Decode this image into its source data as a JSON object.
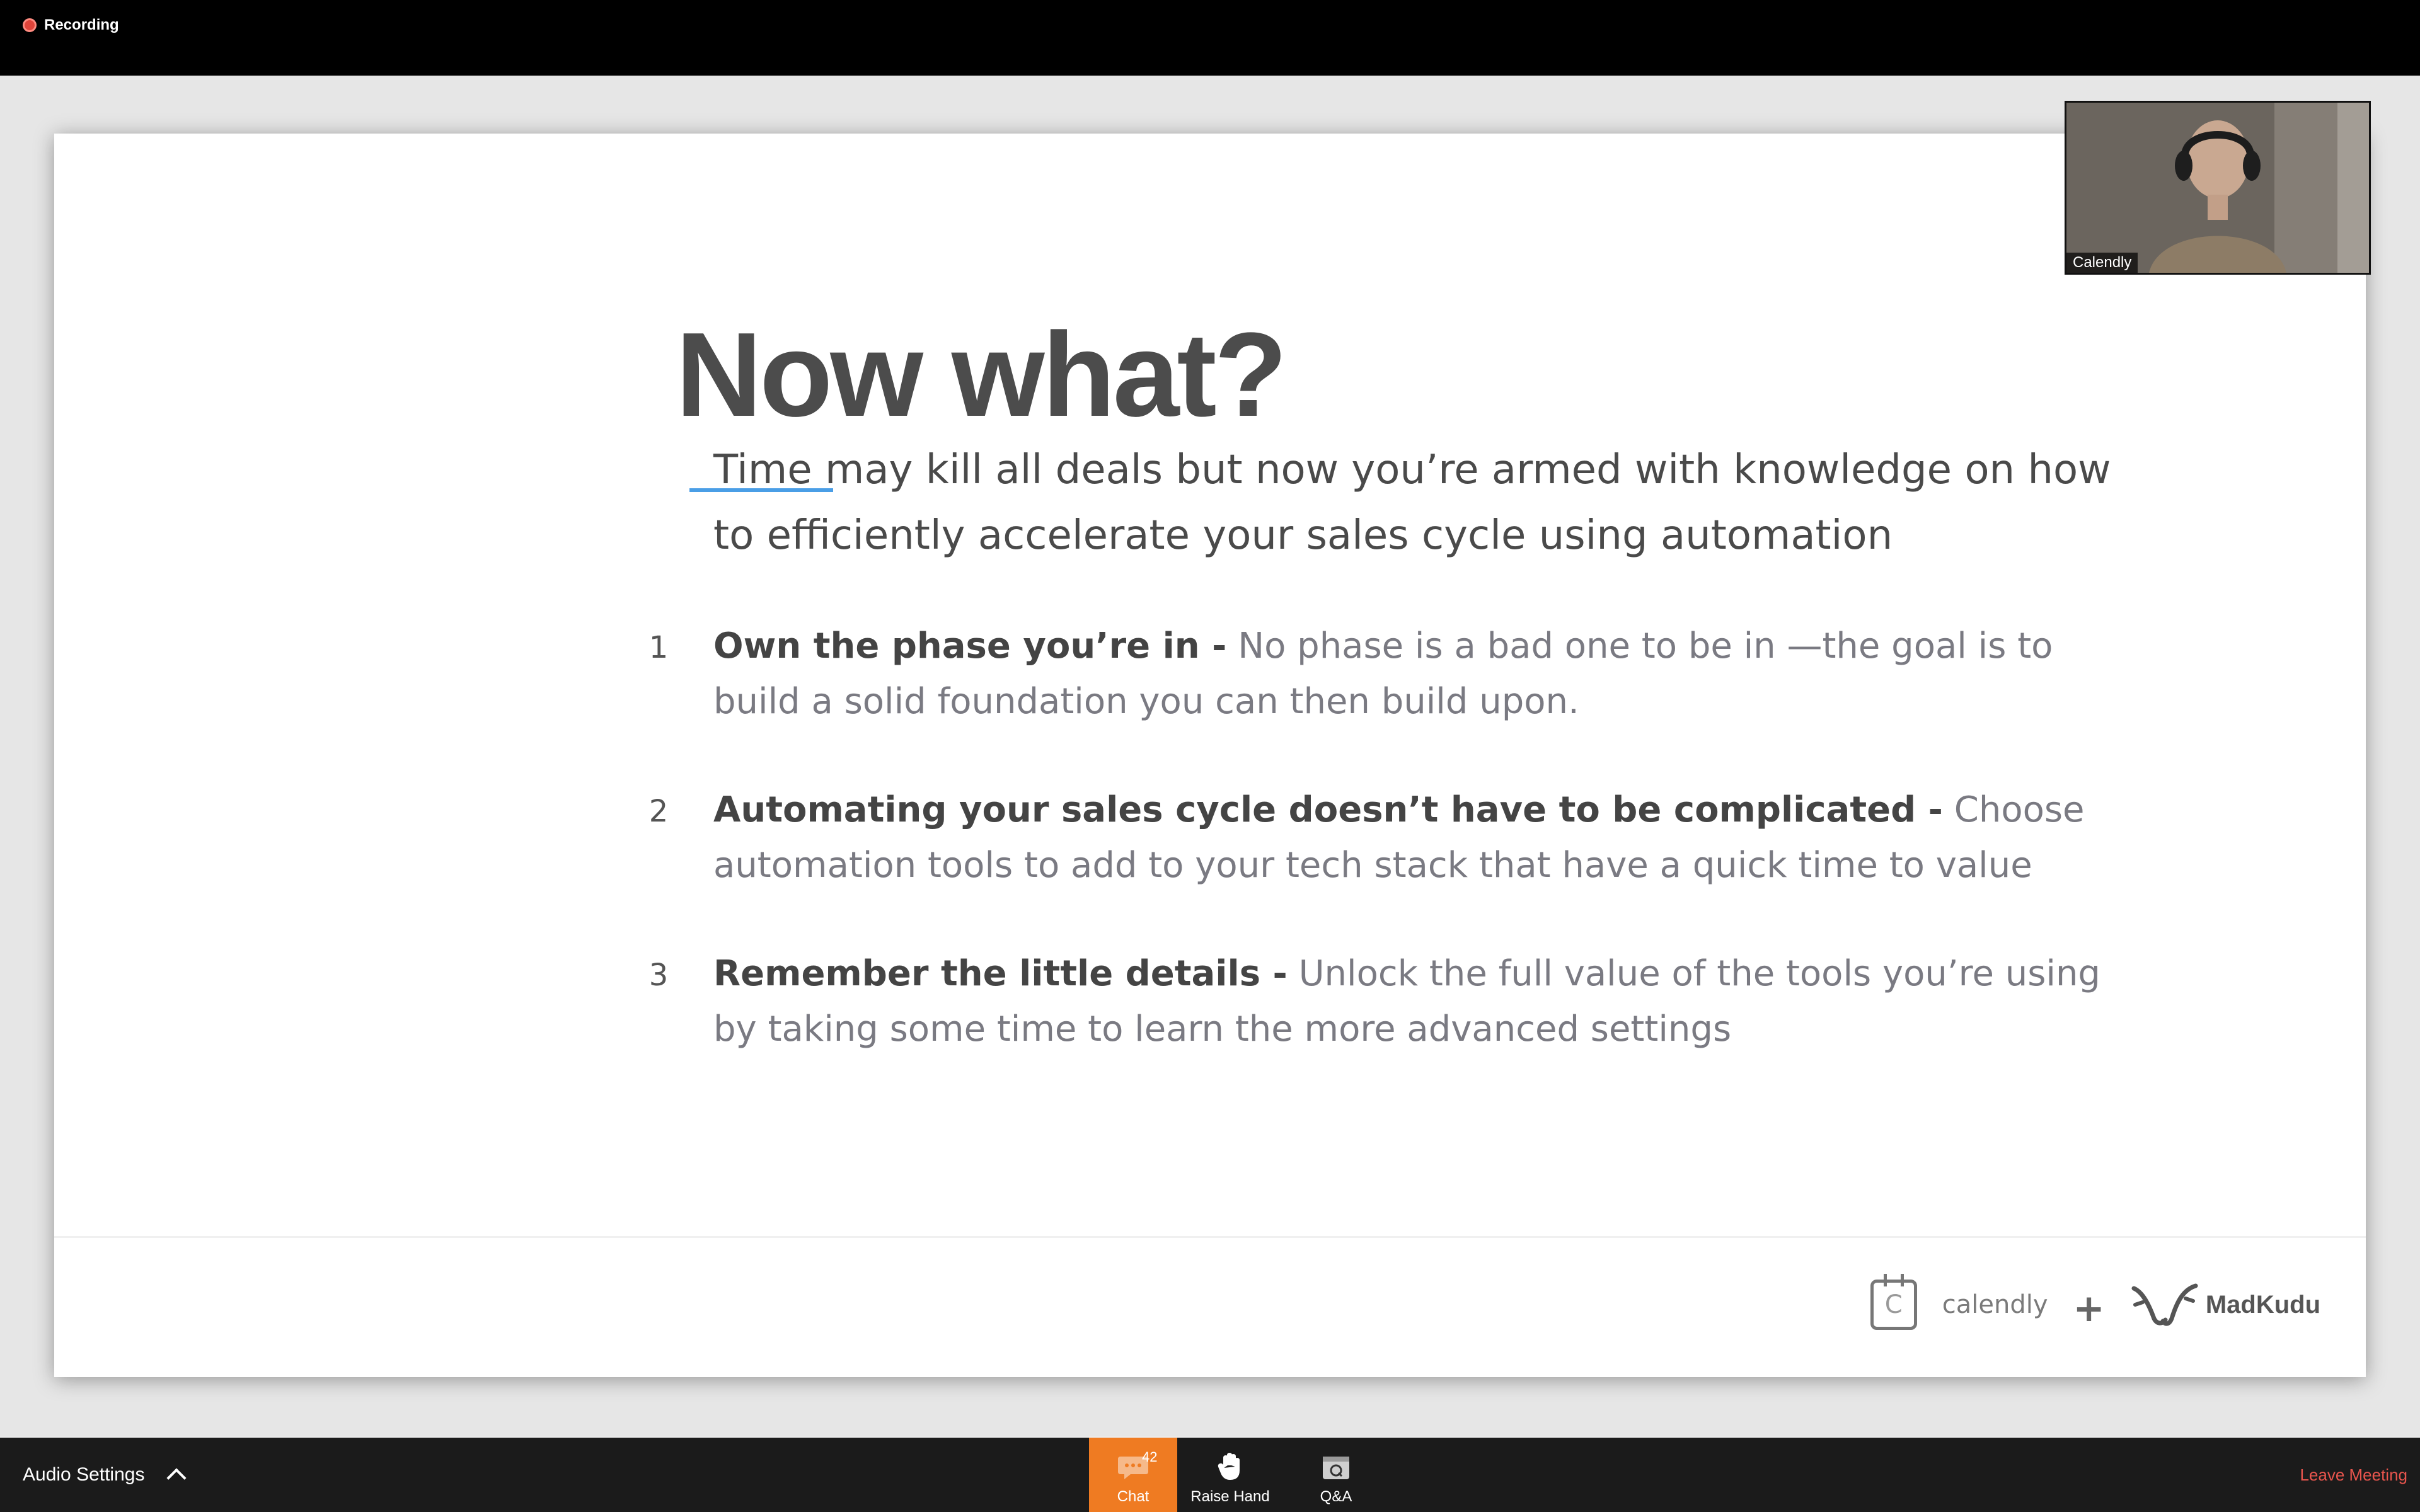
{
  "top_bar": {
    "recording_label": "Recording"
  },
  "video": {
    "participant_name": "Calendly"
  },
  "slide": {
    "title": "Now what?",
    "intro": "Time may kill all deals but now you’re armed with knowledge on how to efficiently accelerate your sales cycle using automation",
    "points": [
      {
        "number": "1",
        "bold": "Own the phase you’re in -",
        "text": " No phase is a bad one to be in —the goal is to build a solid foundation you can then build upon."
      },
      {
        "number": "2",
        "bold": "Automating your sales cycle doesn’t have to be complicated -",
        "text": " Choose automation tools to add to your tech stack that have a quick time to value"
      },
      {
        "number": "3",
        "bold": "Remember the little details -",
        "text": " Unlock the full value of the tools you’re using by taking some time to learn the more advanced settings"
      }
    ],
    "footer": {
      "calendly_label": "calendly",
      "calendly_icon_letter": "C",
      "plus": "+",
      "madkudu_label": "MadKudu"
    },
    "accent_color": "#4a9ee6"
  },
  "bottom_bar": {
    "audio_settings": "Audio Settings",
    "chat_label": "Chat",
    "chat_count": "42",
    "raise_hand_label": "Raise Hand",
    "qa_label": "Q&A",
    "leave_label": "Leave Meeting",
    "chat_color": "#ef7b22",
    "leave_color": "#e8554d"
  }
}
